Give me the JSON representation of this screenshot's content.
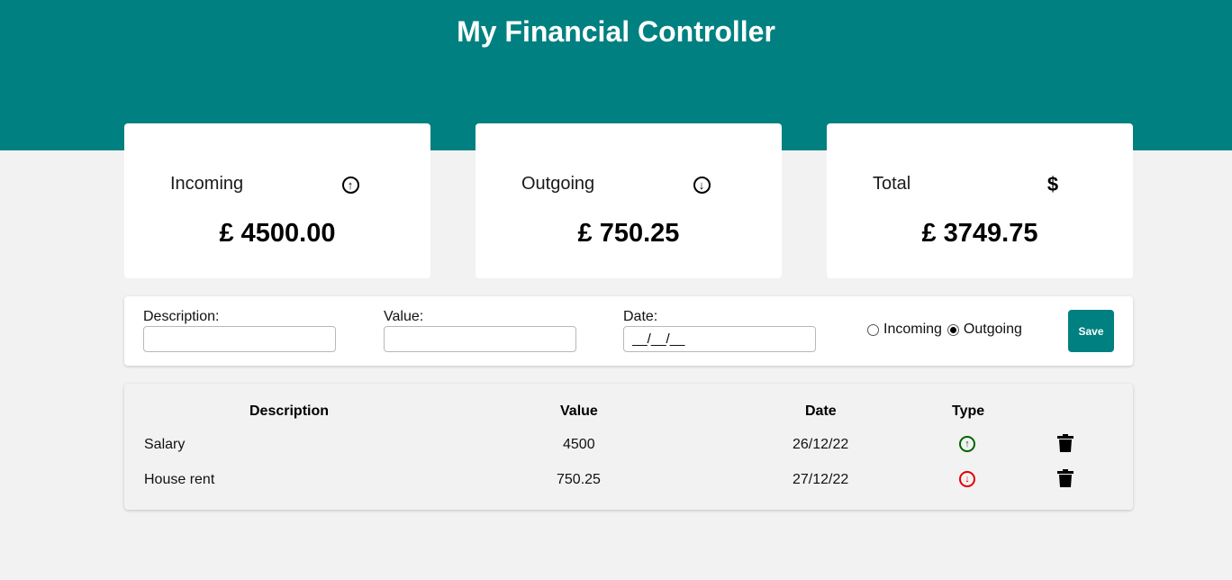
{
  "header": {
    "title": "My Financial Controller"
  },
  "cards": [
    {
      "label": "Incoming",
      "icon": "arrow-up-circle-icon",
      "amount": "£ 4500.00"
    },
    {
      "label": "Outgoing",
      "icon": "arrow-down-circle-icon",
      "amount": "£ 750.25"
    },
    {
      "label": "Total",
      "icon": "dollar-icon",
      "amount": "£ 3749.75"
    }
  ],
  "form": {
    "description_label": "Description:",
    "description_value": "",
    "value_label": "Value:",
    "value_value": "",
    "date_label": "Date:",
    "date_value": "__/__/__",
    "radio_incoming": "Incoming",
    "radio_outgoing": "Outgoing",
    "selected_type": "Outgoing",
    "save_label": "Save"
  },
  "table": {
    "headers": [
      "Description",
      "Value",
      "Date",
      "Type"
    ],
    "rows": [
      {
        "description": "Salary",
        "value": "4500",
        "date": "26/12/22",
        "type": "incoming"
      },
      {
        "description": "House rent",
        "value": "750.25",
        "date": "27/12/22",
        "type": "outgoing"
      }
    ]
  },
  "colors": {
    "brand": "#008080",
    "incoming": "#006400",
    "outgoing": "#e00000"
  }
}
